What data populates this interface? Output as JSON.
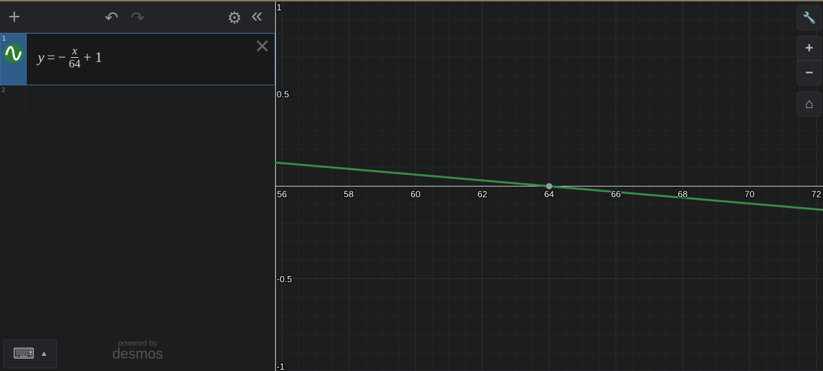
{
  "toolbar": {
    "add": "+",
    "undo": "↶",
    "redo": "↷",
    "settings": "⚙",
    "collapse": "«"
  },
  "expressions": [
    {
      "index": "1",
      "lhs": "y",
      "eq": "=",
      "minus": "−",
      "numerator": "x",
      "denominator": "64",
      "tail": "+ 1",
      "color": "#388c46"
    },
    {
      "index": "2"
    }
  ],
  "keyboard": {
    "icon": "⌨",
    "arrow": "▲"
  },
  "branding": {
    "powered": "powered by",
    "name": "desmos"
  },
  "graph_controls": {
    "wrench": "🔧",
    "zoom_in": "+",
    "zoom_out": "−",
    "home": "⌂"
  },
  "axes": {
    "x_labels": [
      "56",
      "58",
      "60",
      "62",
      "64",
      "66",
      "68",
      "70",
      "72"
    ],
    "y_labels": [
      "1",
      "0.5",
      "-0.5",
      "-1"
    ],
    "xmin": 55.8,
    "xmax": 72.2,
    "ymin": -1,
    "ymax": 1
  },
  "curve": {
    "slope": -0.015625,
    "intercept": 1,
    "color": "#388c46",
    "point": {
      "x": 64,
      "y": 0
    }
  }
}
